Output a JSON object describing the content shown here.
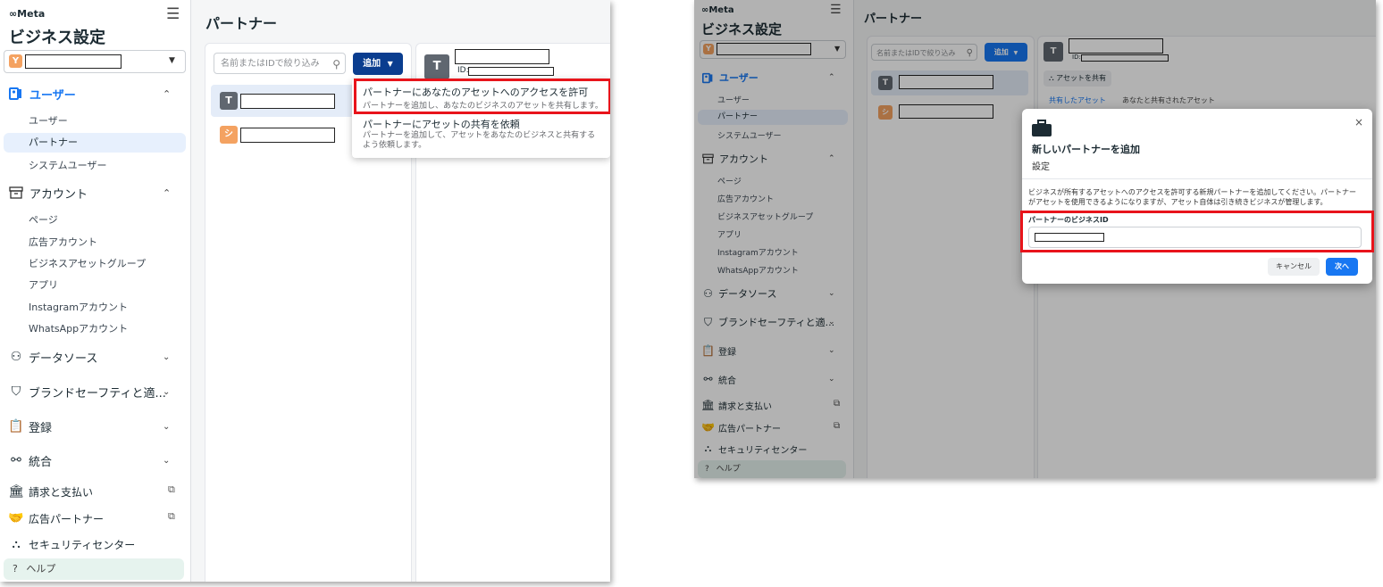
{
  "meta_logo": "∞Meta",
  "app_title": "ビジネス設定",
  "business_badge": "Y",
  "page_title": "パートナー",
  "nav": {
    "users": "ユーザー",
    "users_sub": [
      "ユーザー",
      "パートナー",
      "システムユーザー"
    ],
    "accounts": "アカウント",
    "accounts_sub": [
      "ページ",
      "広告アカウント",
      "ビジネスアセットグループ",
      "アプリ",
      "Instagramアカウント",
      "WhatsAppアカウント"
    ],
    "data_sources": "データソース",
    "brand_safety": "ブランドセーフティと適...",
    "registration": "登録",
    "integrations": "統合",
    "billing": "請求と支払い",
    "ad_partners": "広告パートナー",
    "security_center": "セキュリティセンター",
    "help": "ヘルプ"
  },
  "search_placeholder": "名前またはIDで絞り込み",
  "add_label": "追加",
  "partner_avatars": [
    "T",
    "シ"
  ],
  "detail_avatar": "T",
  "id_label": "ID:",
  "dropdown": [
    {
      "title": "パートナーにあなたのアセットへのアクセスを許可",
      "desc": "パートナーを追加し、あなたのビジネスのアセットを共有します。"
    },
    {
      "title": "パートナーにアセットの共有を依頼",
      "desc": "パートナーを追加して、アセットをあなたのビジネスと共有するよう依頼します。"
    }
  ],
  "detail": {
    "share_button": "アセットを共有",
    "tab_shared": "共有したアセット",
    "tab_shared_with_you": "あなたと共有されたアセット"
  },
  "modal": {
    "title": "新しいパートナーを追加",
    "subtitle": "設定",
    "description": "ビジネスが所有するアセットへのアクセスを許可する新規パートナーを追加してください。パートナーがアセットを使用できるようになりますが、アセット自体は引き続きビジネスが管理します。",
    "field_label": "パートナーのビジネスID",
    "cancel": "キャンセル",
    "next": "次へ"
  },
  "colors": {
    "accent": "#0a3d8f",
    "primary_button": "#1877f2",
    "highlight": "#e8141b",
    "badge_orange": "#f4a261"
  }
}
